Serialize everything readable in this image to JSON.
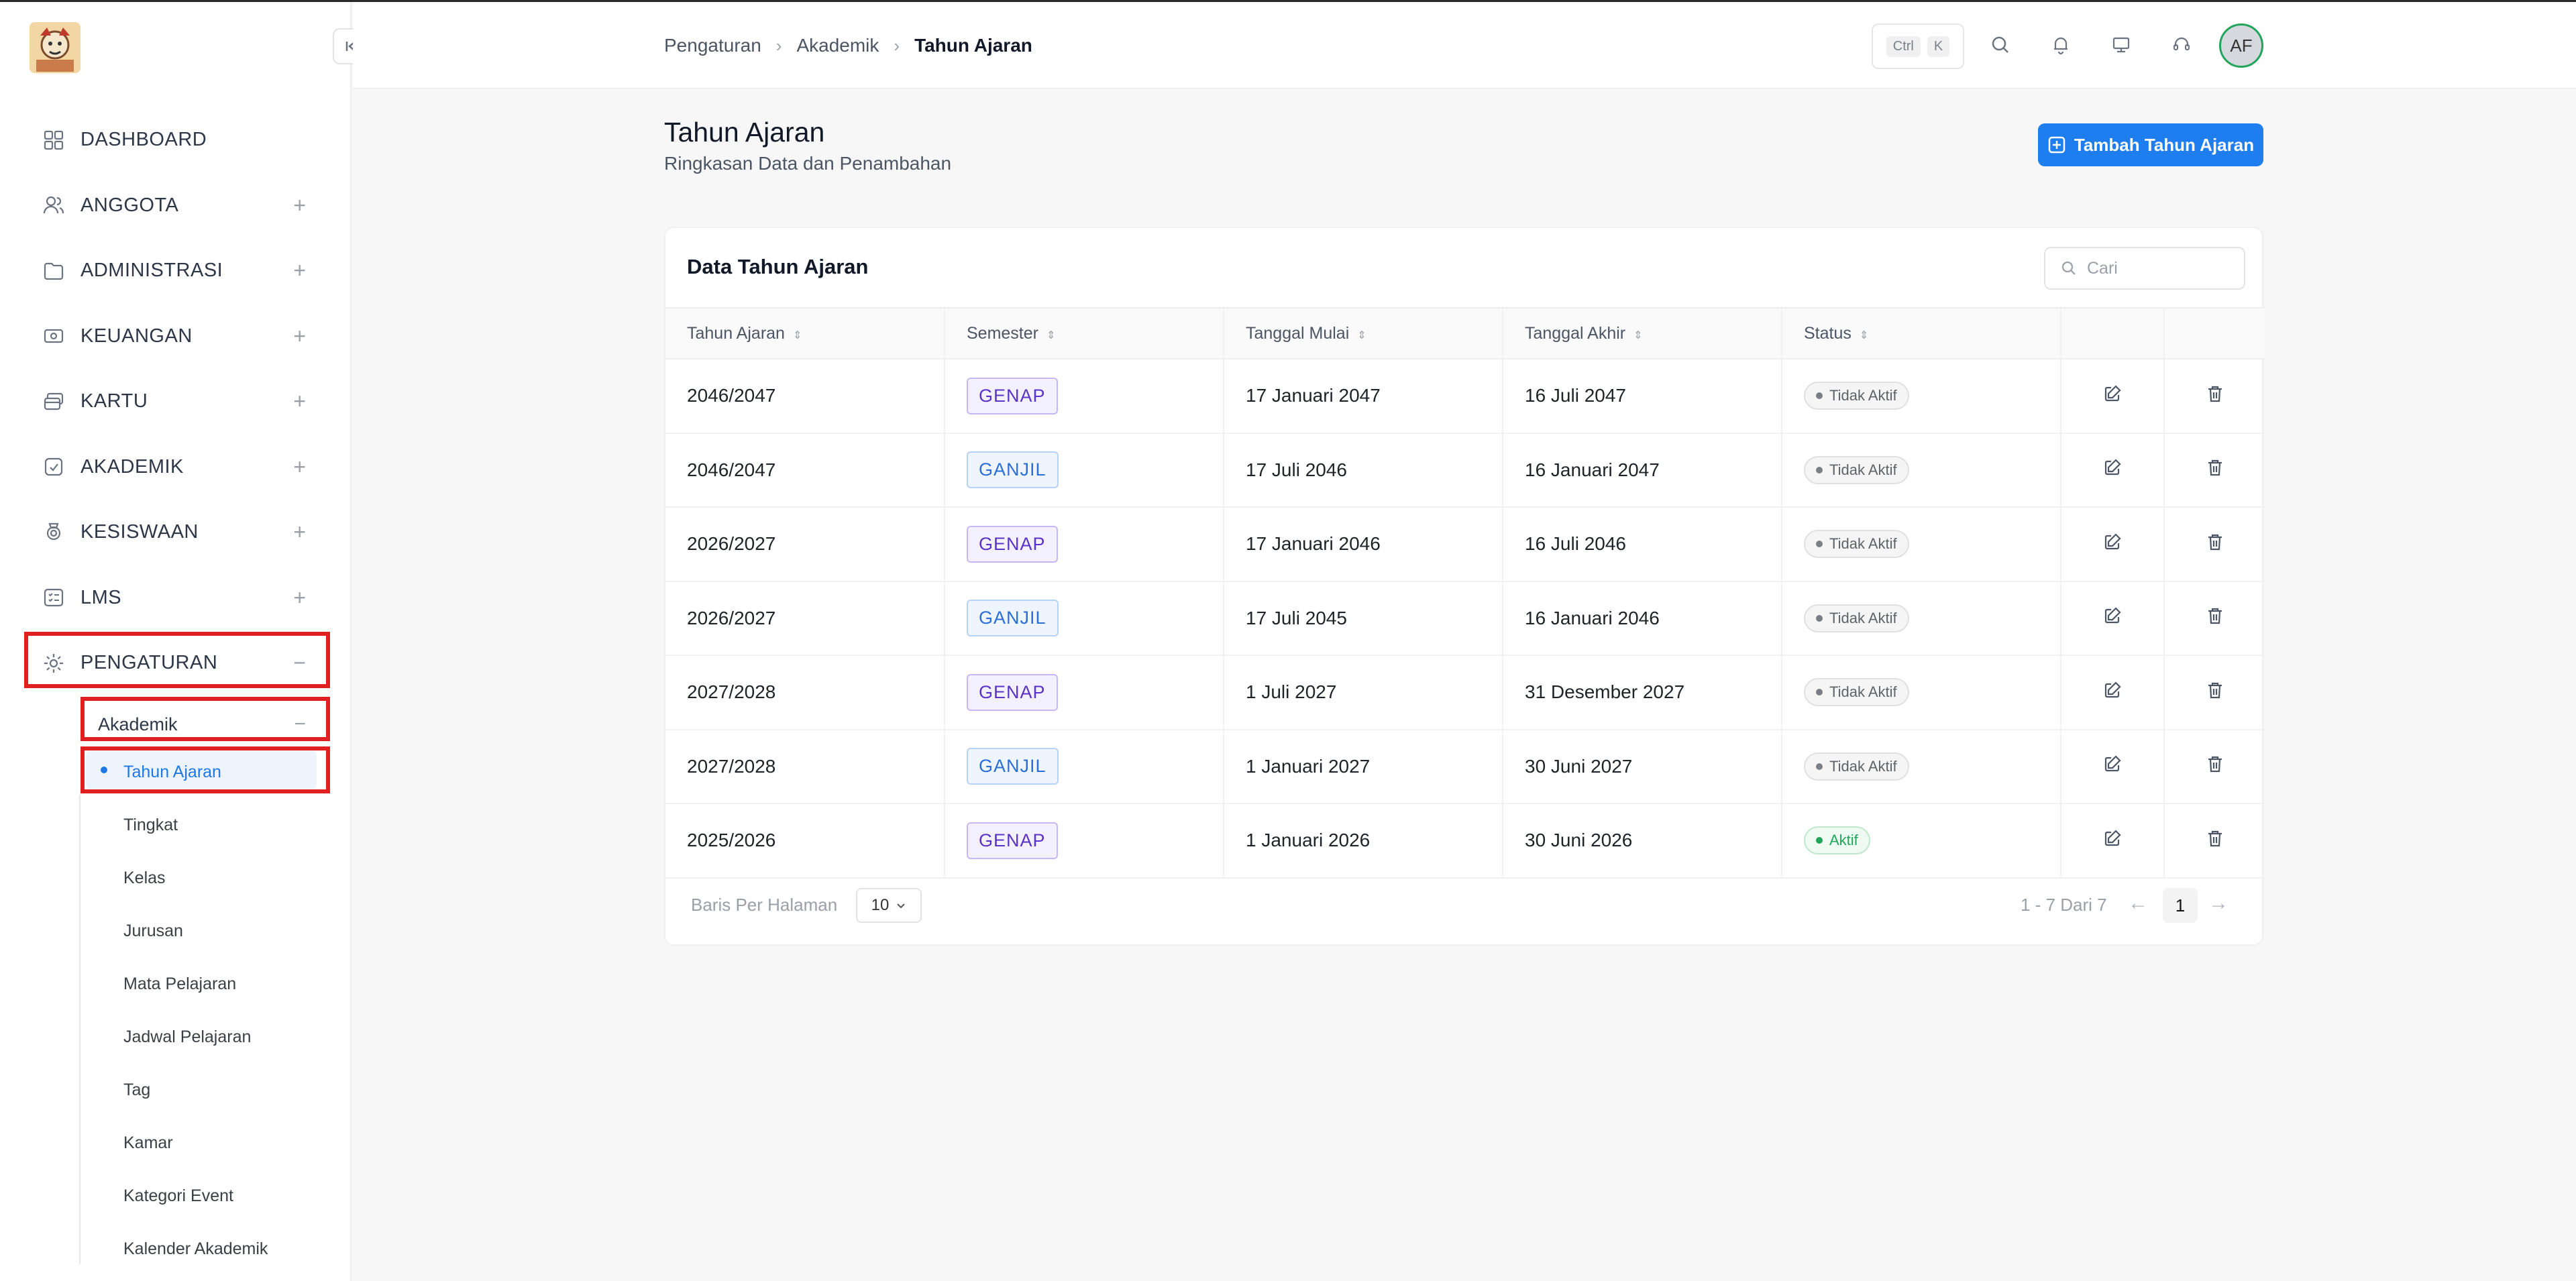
{
  "breadcrumb": [
    "Pengaturan",
    "Akademik",
    "Tahun Ajaran"
  ],
  "header": {
    "kbd_ctrl": "Ctrl",
    "kbd_k": "K",
    "avatar": "AF"
  },
  "sidebar": {
    "items": [
      {
        "label": "DASHBOARD",
        "icon": "dashboard-icon",
        "expander": ""
      },
      {
        "label": "ANGGOTA",
        "icon": "users-icon",
        "expander": "+"
      },
      {
        "label": "ADMINISTRASI",
        "icon": "folder-icon",
        "expander": "+"
      },
      {
        "label": "KEUANGAN",
        "icon": "money-icon",
        "expander": "+"
      },
      {
        "label": "KARTU",
        "icon": "cards-icon",
        "expander": "+"
      },
      {
        "label": "AKADEMIK",
        "icon": "academic-icon",
        "expander": "+"
      },
      {
        "label": "KESISWAAN",
        "icon": "medal-icon",
        "expander": "+"
      },
      {
        "label": "LMS",
        "icon": "list-icon",
        "expander": "+"
      },
      {
        "label": "PENGATURAN",
        "icon": "gear-icon",
        "expander": "−"
      }
    ],
    "subgroup": {
      "label": "Akademik",
      "expander": "−"
    },
    "subitems": [
      "Tahun Ajaran",
      "Tingkat",
      "Kelas",
      "Jurusan",
      "Mata Pelajaran",
      "Jadwal Pelajaran",
      "Tag",
      "Kamar",
      "Kategori Event",
      "Kalender Akademik"
    ]
  },
  "page": {
    "title": "Tahun Ajaran",
    "subtitle": "Ringkasan Data dan Penambahan",
    "add_button": "Tambah Tahun Ajaran"
  },
  "card": {
    "title": "Data Tahun Ajaran",
    "search_placeholder": "Cari",
    "columns": [
      "Tahun Ajaran",
      "Semester",
      "Tanggal Mulai",
      "Tanggal Akhir",
      "Status"
    ],
    "rows": [
      {
        "tahun": "2046/2047",
        "semester": "GENAP",
        "mulai": "17 Januari 2047",
        "akhir": "16 Juli 2047",
        "status": "Tidak Aktif"
      },
      {
        "tahun": "2046/2047",
        "semester": "GANJIL",
        "mulai": "17 Juli 2046",
        "akhir": "16 Januari 2047",
        "status": "Tidak Aktif"
      },
      {
        "tahun": "2026/2027",
        "semester": "GENAP",
        "mulai": "17 Januari 2046",
        "akhir": "16 Juli 2046",
        "status": "Tidak Aktif"
      },
      {
        "tahun": "2026/2027",
        "semester": "GANJIL",
        "mulai": "17 Juli 2045",
        "akhir": "16 Januari 2046",
        "status": "Tidak Aktif"
      },
      {
        "tahun": "2027/2028",
        "semester": "GENAP",
        "mulai": "1 Juli 2027",
        "akhir": "31 Desember 2027",
        "status": "Tidak Aktif"
      },
      {
        "tahun": "2027/2028",
        "semester": "GANJIL",
        "mulai": "1 Januari 2027",
        "akhir": "30 Juni 2027",
        "status": "Tidak Aktif"
      },
      {
        "tahun": "2025/2026",
        "semester": "GENAP",
        "mulai": "1 Januari 2026",
        "akhir": "30 Juni 2026",
        "status": "Aktif"
      }
    ],
    "pagination": {
      "rows_per_page_label": "Baris Per Halaman",
      "rows_per_page": "10",
      "range": "1 - 7 Dari 7",
      "current_page": "1"
    }
  },
  "colors": {
    "accent": "#1e7ef0",
    "highlight": "#e02020",
    "active_green": "#22a55a"
  }
}
